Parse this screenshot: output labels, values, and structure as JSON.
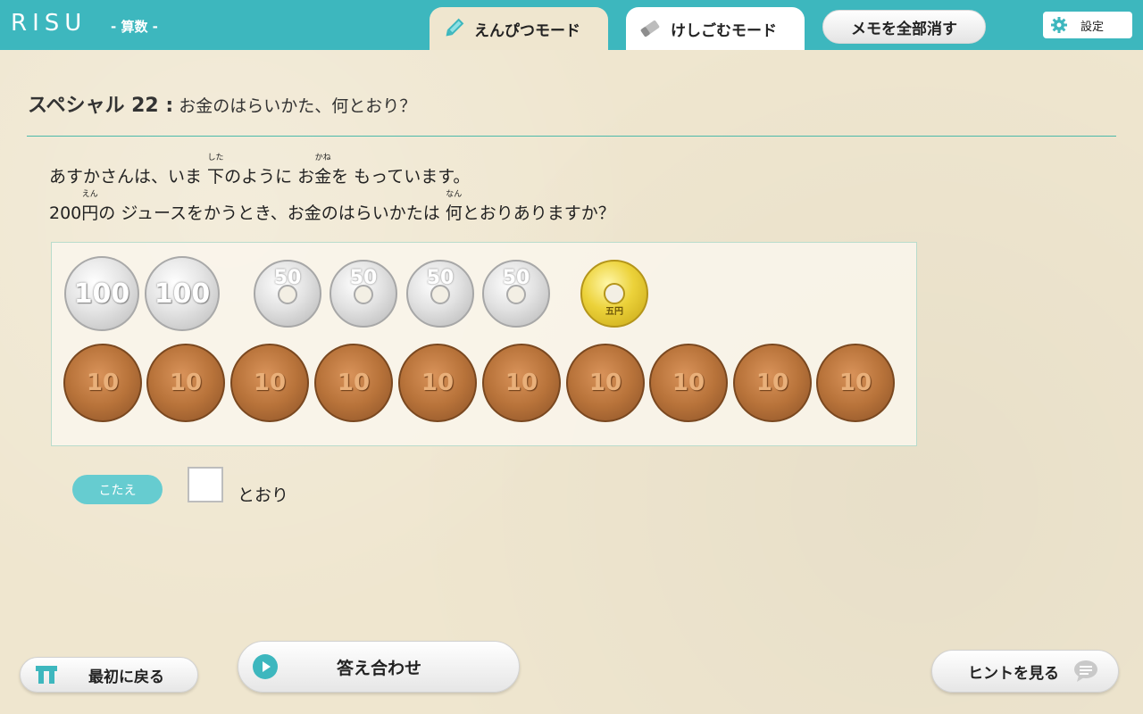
{
  "header": {
    "logo": "RISU",
    "subject": "- 算数 -",
    "tab_pencil": "えんぴつモード",
    "tab_eraser": "けしごむモード",
    "clear_memo": "メモを全部消す",
    "settings": "設定",
    "accent_color": "#3db7be"
  },
  "problem": {
    "label": "スペシャル 22 :",
    "title": "お金のはらいかた、何とおり？",
    "line1": {
      "a": "あすかさんは、いま ",
      "ruby1_base": "下",
      "ruby1_reading": "した",
      "b": "のように お",
      "ruby2_base": "金",
      "ruby2_reading": "かね",
      "c": "を もっています。"
    },
    "line2": {
      "a": "200",
      "ruby1_base": "円",
      "ruby1_reading": "えん",
      "b": "の ジュースをかうとき、お金のはらいかたは ",
      "ruby2_base": "何",
      "ruby2_reading": "なん",
      "c": "とおりありますか？"
    }
  },
  "coins": {
    "row1": [
      {
        "type": "100",
        "label": "100"
      },
      {
        "type": "100",
        "label": "100"
      },
      {
        "type": "50",
        "label": "50"
      },
      {
        "type": "50",
        "label": "50"
      },
      {
        "type": "50",
        "label": "50"
      },
      {
        "type": "50",
        "label": "50"
      },
      {
        "type": "5",
        "label": "五円"
      }
    ],
    "row2": [
      {
        "type": "10",
        "label": "10"
      },
      {
        "type": "10",
        "label": "10"
      },
      {
        "type": "10",
        "label": "10"
      },
      {
        "type": "10",
        "label": "10"
      },
      {
        "type": "10",
        "label": "10"
      },
      {
        "type": "10",
        "label": "10"
      },
      {
        "type": "10",
        "label": "10"
      },
      {
        "type": "10",
        "label": "10"
      },
      {
        "type": "10",
        "label": "10"
      },
      {
        "type": "10",
        "label": "10"
      }
    ]
  },
  "answer": {
    "badge": "こたえ",
    "value": "",
    "suffix": "とおり"
  },
  "footer": {
    "home": "最初に戻る",
    "check": "答え合わせ",
    "hint": "ヒントを見る"
  }
}
